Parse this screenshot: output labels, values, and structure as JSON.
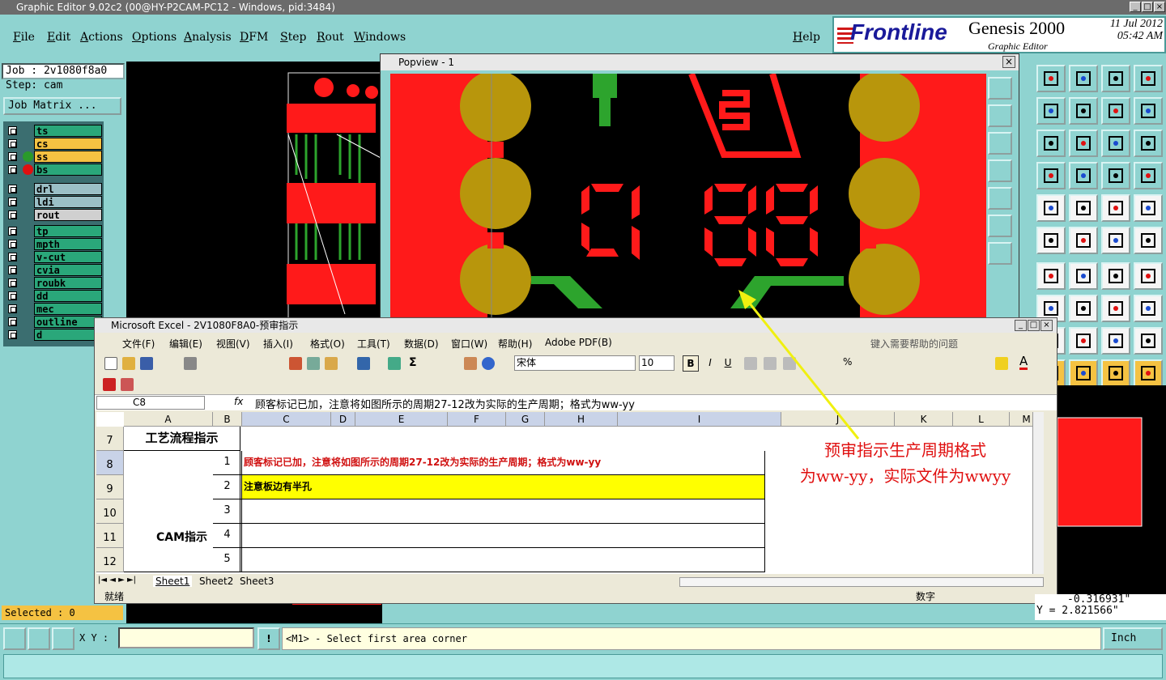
{
  "window": {
    "title": "Graphic Editor 9.02c2 (00@HY-P2CAM-PC12 - Windows, pid:3484)"
  },
  "menu": [
    "File",
    "Edit",
    "Actions",
    "Options",
    "Analysis",
    "DFM",
    "Step",
    "Rout",
    "Windows"
  ],
  "help": "Help",
  "brand": {
    "logo": "Frontline",
    "product": "Genesis 2000",
    "subtitle": "Graphic Editor",
    "date": "11 Jul 2012",
    "time": "05:42 AM"
  },
  "job": {
    "job_label": "Job : 2v1080f8a0",
    "step_label": "Step: cam",
    "matrix_button": "Job Matrix ..."
  },
  "layers": [
    {
      "name": "ts",
      "color": "#2aa77a",
      "dot": ""
    },
    {
      "name": "cs",
      "color": "#f5c242",
      "dot": ""
    },
    {
      "name": "ss",
      "color": "#f5c242",
      "dot": "#2a9a2a"
    },
    {
      "name": "bs",
      "color": "#2aa77a",
      "dot": "#e01010"
    },
    {
      "name": "drl",
      "color": "#9bbfc6",
      "dot": ""
    },
    {
      "name": "ldi",
      "color": "#9bbfc6",
      "dot": ""
    },
    {
      "name": "rout",
      "color": "#d0d0d0",
      "dot": ""
    },
    {
      "name": "tp",
      "color": "#2aa77a",
      "dot": ""
    },
    {
      "name": "mpth",
      "color": "#2aa77a",
      "dot": ""
    },
    {
      "name": "v-cut",
      "color": "#2aa77a",
      "dot": ""
    },
    {
      "name": "cvia",
      "color": "#2aa77a",
      "dot": ""
    },
    {
      "name": "roubk",
      "color": "#2aa77a",
      "dot": ""
    },
    {
      "name": "dd",
      "color": "#2aa77a",
      "dot": ""
    },
    {
      "name": "mec",
      "color": "#2aa77a",
      "dot": ""
    },
    {
      "name": "outline",
      "color": "#2aa77a",
      "dot": ""
    },
    {
      "name": "d",
      "color": "#2aa77a",
      "dot": ""
    }
  ],
  "popview": {
    "title": "Popview - 1"
  },
  "excel": {
    "title": "Microsoft Excel - 2V1080F8A0-预审指示",
    "menu": [
      "文件(F)",
      "编辑(E)",
      "视图(V)",
      "插入(I)",
      "格式(O)",
      "工具(T)",
      "数据(D)",
      "窗口(W)",
      "帮助(H)",
      "Adobe PDF(B)"
    ],
    "help_box": "键入需要帮助的问题",
    "font": "宋体",
    "font_size": "10",
    "name_box": "C8",
    "formula": "顾客标记已加，注意将如图所示的周期27-12改为实际的生产周期；格式为ww-yy",
    "columns": [
      "A",
      "B",
      "C",
      "D",
      "E",
      "F",
      "G",
      "H",
      "I",
      "J",
      "K",
      "L",
      "M"
    ],
    "rows": [
      "7",
      "8",
      "9",
      "10",
      "11",
      "12"
    ],
    "row7_title": "工艺流程指示",
    "cam_label": "CAM指示",
    "items": [
      {
        "num": "1",
        "text": "顾客标记已加，注意将如图所示的周期27-12改为实际的生产周期；格式为ww-yy"
      },
      {
        "num": "2",
        "text": "注意板边有半孔"
      },
      {
        "num": "3",
        "text": ""
      },
      {
        "num": "4",
        "text": ""
      },
      {
        "num": "5",
        "text": ""
      }
    ],
    "sheets": [
      "Sheet1",
      "Sheet2",
      "Sheet3"
    ],
    "status_left": "就绪",
    "status_right": "数字"
  },
  "annotation": {
    "line1": "预审指示生产周期格式",
    "line2": "为ww-yy，实际文件为wwyy"
  },
  "selected": "Selected : 0",
  "coords": {
    "x": "-0.316931\"",
    "y": "Y = 2.821566\""
  },
  "bottom": {
    "xy_label": "X Y :",
    "prompt": "<M1> - Select first area corner",
    "units": "Inch"
  }
}
